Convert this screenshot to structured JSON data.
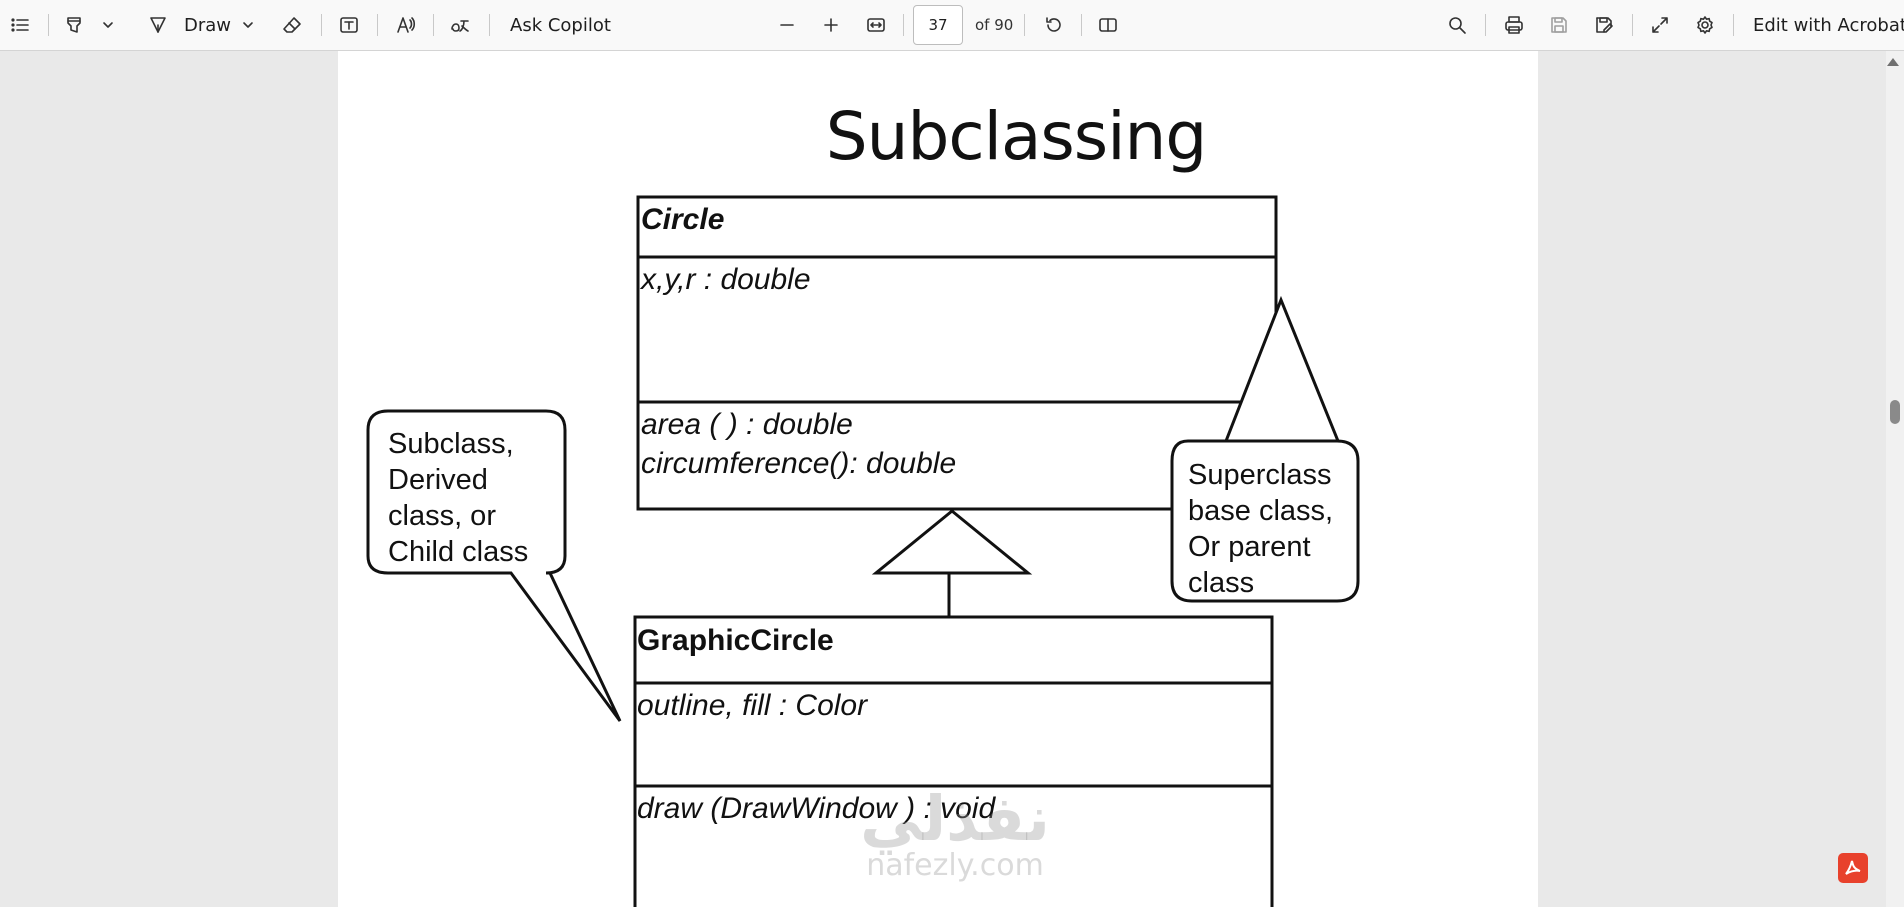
{
  "toolbar": {
    "draw_label": "Draw",
    "ask_copilot_label": "Ask Copilot",
    "page_current": "37",
    "page_total_label": "of 90",
    "edit_with_acrobat_label": "Edit with Acrobat",
    "icons": [
      "contents-icon",
      "highlight-icon",
      "chevron-down-icon",
      "draw-icon",
      "eraser-icon",
      "text-box-icon",
      "read-aloud-icon",
      "translate-icon",
      "zoom-out-icon",
      "zoom-in-icon",
      "fit-width-icon",
      "rotate-icon",
      "page-view-icon",
      "search-icon",
      "print-icon",
      "save-icon",
      "save-as-icon",
      "fullscreen-icon",
      "settings-icon"
    ]
  },
  "slide": {
    "title": "Subclassing",
    "superclass": {
      "name": "Circle",
      "attribute": "x,y,r  : double",
      "method_1": "area ( ) : double",
      "method_2": "circumference(): double"
    },
    "subclass": {
      "name": "GraphicCircle",
      "attribute": "outline, fill  : Color",
      "method_1": "draw (DrawWindow ) : void"
    },
    "callout_left": {
      "line_1": "Subclass,",
      "line_2": "Derived",
      "line_3": "class, or",
      "line_4": "Child class"
    },
    "callout_right": {
      "line_1": "Superclass",
      "line_2": "base class,",
      "line_3": "Or parent",
      "line_4": "class"
    },
    "watermark_arabic": "نفذلي",
    "watermark_latin": "nafezly.com"
  }
}
